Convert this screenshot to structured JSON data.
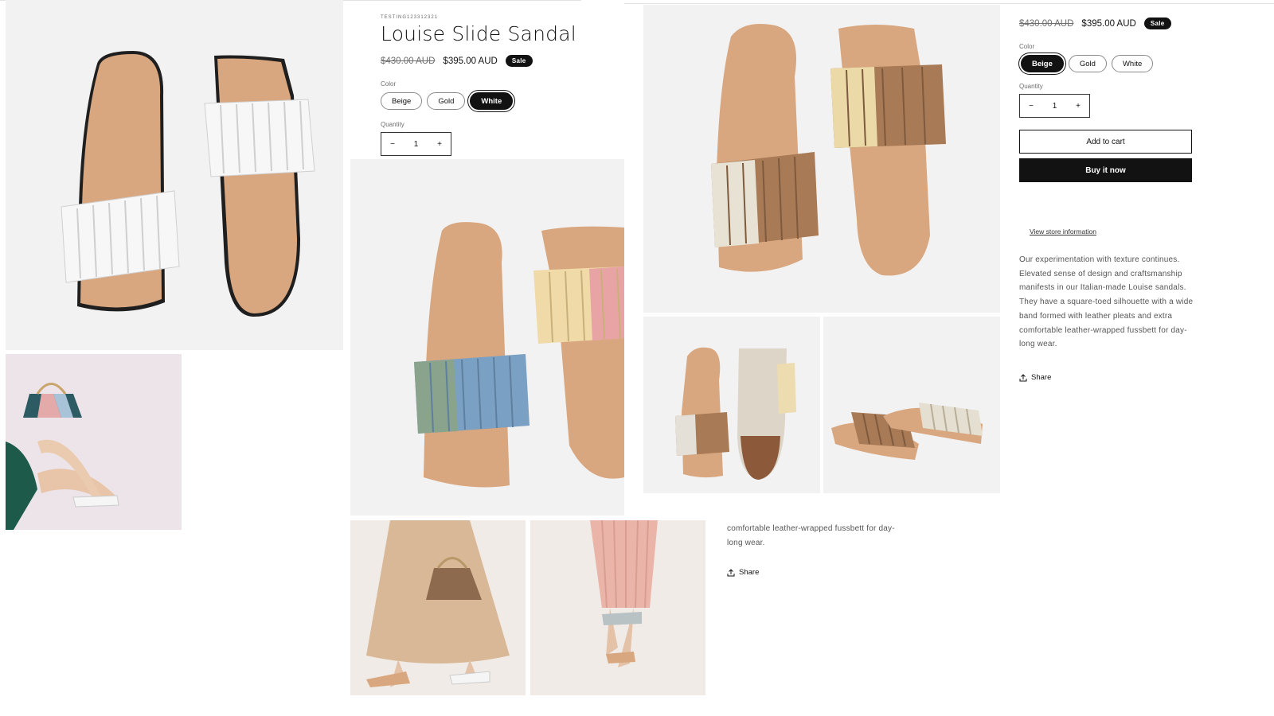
{
  "product": {
    "vendor": "TESTING123312321",
    "title": "Louise Slide Sandal",
    "price_regular": "$430.00 AUD",
    "price_sale": "$395.00 AUD",
    "sale_badge": "Sale",
    "color_label": "Color",
    "quantity_label": "Quantity",
    "quantity_value": "1",
    "decrement": "−",
    "increment": "+"
  },
  "left_panel": {
    "colors": [
      {
        "label": "Beige",
        "selected": false
      },
      {
        "label": "Gold",
        "selected": false
      },
      {
        "label": "White",
        "selected": true
      }
    ]
  },
  "right_panel": {
    "colors": [
      {
        "label": "Beige",
        "selected": true
      },
      {
        "label": "Gold",
        "selected": false
      },
      {
        "label": "White",
        "selected": false
      }
    ],
    "add_to_cart": "Add to cart",
    "buy_now": "Buy it now",
    "store_info_link": "View store information",
    "description_lines": [
      "Our experimentation with texture continues.",
      "Elevated sense of design and craftsmanship",
      "manifests in our Italian-made Louise sandals.",
      "They have a square-toed silhouette with a wide",
      "band formed with leather pleats and extra",
      "comfortable leather-wrapped fussbett for day-",
      "long wear."
    ],
    "share_label": "Share"
  },
  "middle_overlap": {
    "description_tail": [
      "comfortable leather-wrapped fussbett for day-",
      "long wear."
    ],
    "share_label": "Share"
  },
  "images": {
    "white_pair": {
      "icon": "white-sandal-pair-image"
    },
    "bag_model": {
      "icon": "model-with-bag-image"
    },
    "multicolor_pair": {
      "icon": "multicolor-sandal-pair-image"
    },
    "beige_walk": {
      "icon": "model-walking-beige-dress-image"
    },
    "pink_walk": {
      "icon": "model-walking-pink-skirt-image"
    },
    "beige_pair": {
      "icon": "beige-sandal-pair-image"
    },
    "beige_sole": {
      "icon": "sandal-sole-view-image"
    },
    "beige_side": {
      "icon": "sandal-side-view-image"
    }
  },
  "colors": {
    "accent": "#121212",
    "image_bg": "#f2f2f2",
    "leather": "#d9a77f",
    "muted_text": "#6f6f6f"
  }
}
